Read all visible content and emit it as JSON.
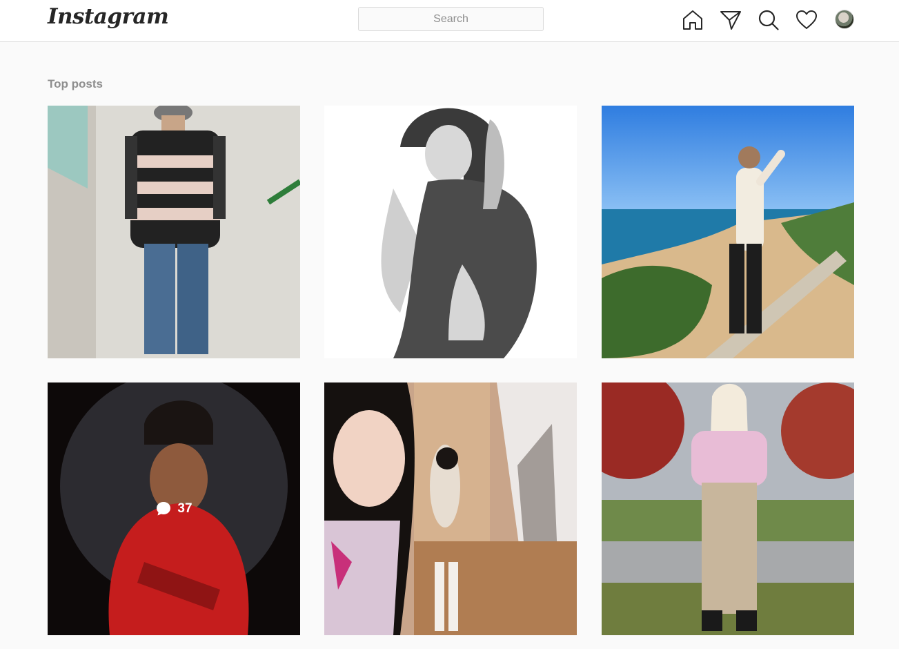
{
  "header": {
    "logo_text": "Instagram",
    "search_placeholder": "Search",
    "icons": [
      "home-icon",
      "direct-icon",
      "explore-icon",
      "activity-heart-icon",
      "profile-avatar"
    ]
  },
  "main": {
    "section_title": "Top posts",
    "posts": [
      {
        "comments": ""
      },
      {
        "comments": ""
      },
      {
        "comments": ""
      },
      {
        "comments": "37"
      },
      {
        "comments": ""
      },
      {
        "comments": ""
      }
    ]
  },
  "colors": {
    "background": "#fafafa",
    "header_bg": "#ffffff",
    "border": "#dbdbdb",
    "muted_text": "#8e8e8e",
    "primary_text": "#262626"
  }
}
